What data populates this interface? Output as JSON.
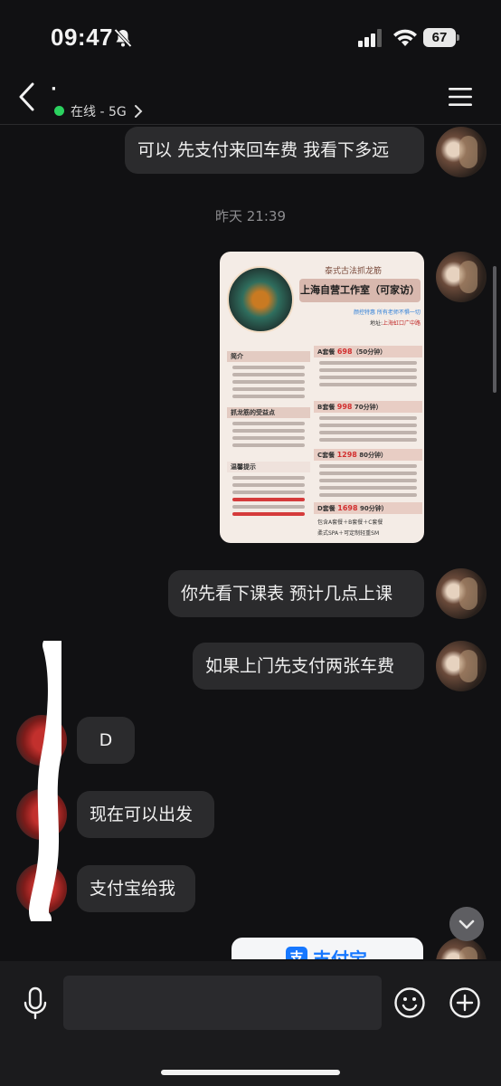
{
  "status_bar": {
    "time": "09:47",
    "battery": "67"
  },
  "header": {
    "contact_name": "·",
    "status": "在线 - 5G"
  },
  "messages": [
    {
      "side": "self",
      "text": "可以 先支付来回车费 我看下多远"
    },
    {
      "side": "self",
      "text": "你先看下课表 预计几点上课"
    },
    {
      "side": "self",
      "text": "如果上门先支付两张车费"
    },
    {
      "side": "peer",
      "text": "D"
    },
    {
      "side": "peer",
      "text": "现在可以出发"
    },
    {
      "side": "peer",
      "text": "支付宝给我"
    }
  ],
  "timestamp": "昨天 21:39",
  "poster": {
    "subtitle": "泰式古法抓龙筋",
    "studio": "上海自营工作室（可家访）",
    "tagline": "颜控特惠 所有老师不惧一切",
    "address_label": "地址:",
    "address": "上海虹口广中路",
    "intro_title": "简介",
    "benefits_title": "抓龙筋的受益点",
    "tips_title": "温馨提示",
    "packages": [
      {
        "name": "A套餐",
        "price": "698",
        "duration": "（50分钟）"
      },
      {
        "name": "B套餐",
        "price": "998",
        "duration": "70分钟）"
      },
      {
        "name": "C套餐",
        "price": "1298",
        "duration": "80分钟）"
      },
      {
        "name": "D套餐",
        "price": "1698",
        "duration": "90分钟）"
      }
    ],
    "d_package_detail_1": "包含A套餐＋B套餐＋C套餐",
    "d_package_detail_2": "柔式SPA＋可定制轻重SM"
  },
  "alipay_card": {
    "logo": "支",
    "label": "支付宝"
  },
  "input": {
    "placeholder": ""
  },
  "colors": {
    "online": "#2bd15f",
    "bubble": "#2b2b2d",
    "background": "#111113",
    "alipay_blue": "#1677ff"
  }
}
